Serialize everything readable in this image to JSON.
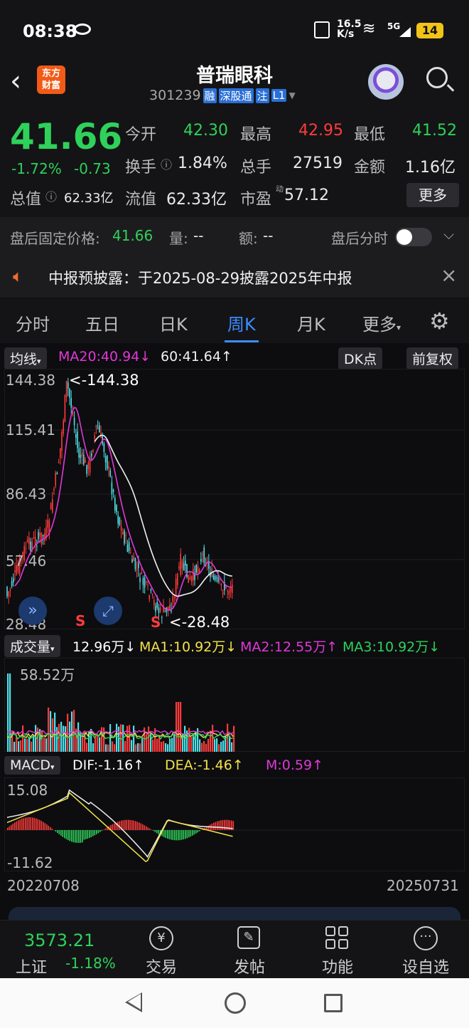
{
  "status_bar": {
    "time": "08:38",
    "net_speed_top": "16.5",
    "net_speed_unit": "K/s",
    "signal": "5G",
    "battery": "14"
  },
  "header": {
    "logo_line1": "东方",
    "logo_line2": "财富",
    "title": "普瑞眼科",
    "code": "301239",
    "tags": [
      "融",
      "深股通",
      "注",
      "L1"
    ]
  },
  "quote": {
    "price": "41.66",
    "change_pct": "-1.72%",
    "change": "-0.73",
    "open_label": "今开",
    "open": "42.30",
    "high_label": "最高",
    "high": "42.95",
    "low_label": "最低",
    "low": "41.52",
    "turnover_label": "换手",
    "turnover": "1.84%",
    "volume_label": "总手",
    "volume": "27519",
    "amount_label": "金额",
    "amount": "1.16亿",
    "mktcap_label": "总值",
    "mktcap": "62.33亿",
    "float_label": "流值",
    "float_cap": "62.33亿",
    "pe_label": "市盈",
    "pe_sup": "动",
    "pe": "57.12",
    "more_label": "更多"
  },
  "after_hours": {
    "price_label": "盘后固定价格:",
    "price": "41.66",
    "qty_label": "量:",
    "qty": "--",
    "amt_label": "额:",
    "amt": "--",
    "time_label": "盘后分时"
  },
  "notice": {
    "text": "中报预披露：于2025-08-29披露2025年中报"
  },
  "tabs": [
    "分时",
    "五日",
    "日K",
    "周K",
    "月K",
    "更多"
  ],
  "active_tab": "周K",
  "kline": {
    "ma_selector": "均线",
    "ma20_label": "MA20:40.94",
    "ma20_arrow": "↓",
    "ma60_label": "60:41.64",
    "ma60_arrow": "↑",
    "dk_label": "DK点",
    "adjust_label": "前复权",
    "axis_labels": [
      "144.38",
      "115.41",
      "86.43",
      "57.46",
      "28.48"
    ],
    "max_annot": "<-144.38",
    "min_annot": "<-28.48",
    "signal_s1": "S",
    "signal_s2": "S"
  },
  "volume": {
    "selector": "成交量",
    "vol_label": "12.96万",
    "vol_arrow": "↓",
    "ma1": "MA1:10.92万",
    "ma1_arrow": "↓",
    "ma2": "MA2:12.55万",
    "ma2_arrow": "↑",
    "ma3": "MA3:10.92万",
    "ma3_arrow": "↓",
    "max_label": "58.52万"
  },
  "macd": {
    "selector": "MACD",
    "dif": "DIF:-1.16",
    "dif_arrow": "↑",
    "dea": "DEA:-1.46",
    "dea_arrow": "↑",
    "m": "M:0.59",
    "m_arrow": "↑",
    "max_label": "15.08",
    "min_label": "-11.62",
    "date_start": "20220708",
    "date_end": "20250731"
  },
  "bottom_nav": {
    "index_value": "3573.21",
    "index_name": "上证",
    "index_change": "-1.18%",
    "items": [
      "交易",
      "发帖",
      "功能",
      "设自选"
    ]
  },
  "colors": {
    "up": "#ff3b3b",
    "down": "#2fd15b",
    "ma_white": "#f0f0f0",
    "ma_magenta": "#e038d8",
    "accent": "#3d8bff",
    "cyan": "#4fe0e8"
  }
}
